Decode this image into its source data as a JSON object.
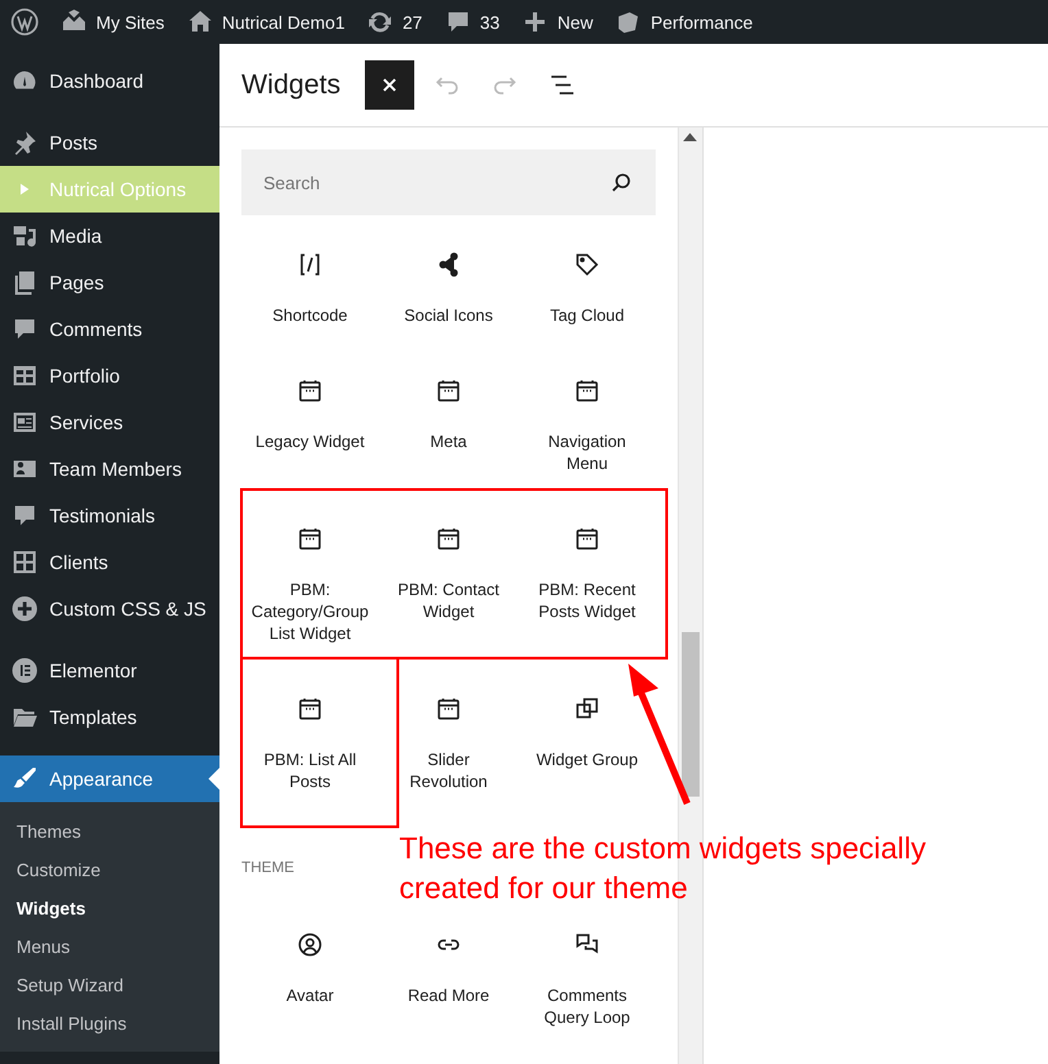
{
  "admin_bar": [
    {
      "kind": "wp"
    },
    {
      "kind": "sites",
      "label": "My Sites"
    },
    {
      "kind": "home",
      "label": "Nutrical Demo1"
    },
    {
      "kind": "updates",
      "label": "27"
    },
    {
      "kind": "comments",
      "label": "33"
    },
    {
      "kind": "new",
      "label": "New"
    },
    {
      "kind": "performance",
      "label": "Performance"
    }
  ],
  "sidebar": {
    "groups": [
      [
        {
          "kind": "dashboard",
          "label": "Dashboard",
          "selected": false,
          "highlighted": false
        }
      ],
      [
        {
          "kind": "pin",
          "label": "Posts",
          "selected": false,
          "highlighted": false
        },
        {
          "kind": "triangle",
          "label": "Nutrical Options",
          "selected": false,
          "highlighted": true
        },
        {
          "kind": "media",
          "label": "Media",
          "selected": false,
          "highlighted": false
        },
        {
          "kind": "pages",
          "label": "Pages",
          "selected": false,
          "highlighted": false
        },
        {
          "kind": "comment",
          "label": "Comments",
          "selected": false,
          "highlighted": false
        },
        {
          "kind": "portfolio",
          "label": "Portfolio",
          "selected": false,
          "highlighted": false
        },
        {
          "kind": "services",
          "label": "Services",
          "selected": false,
          "highlighted": false
        },
        {
          "kind": "team",
          "label": "Team Members",
          "selected": false,
          "highlighted": false
        },
        {
          "kind": "testimonial",
          "label": "Testimonials",
          "selected": false,
          "highlighted": false
        },
        {
          "kind": "grid",
          "label": "Clients",
          "selected": false,
          "highlighted": false
        },
        {
          "kind": "plus",
          "label": "Custom CSS & JS",
          "selected": false,
          "highlighted": false
        }
      ],
      [
        {
          "kind": "elementor",
          "label": "Elementor",
          "selected": false,
          "highlighted": false
        },
        {
          "kind": "folder",
          "label": "Templates",
          "selected": false,
          "highlighted": false
        }
      ],
      [
        {
          "kind": "brush",
          "label": "Appearance",
          "selected": true,
          "highlighted": false,
          "children": [
            {
              "label": "Themes",
              "selected": false
            },
            {
              "label": "Customize",
              "selected": false
            },
            {
              "label": "Widgets",
              "selected": true
            },
            {
              "label": "Menus",
              "selected": false
            },
            {
              "label": "Setup Wizard",
              "selected": false
            },
            {
              "label": "Install Plugins",
              "selected": false
            }
          ]
        }
      ]
    ]
  },
  "header": {
    "title": "Widgets",
    "tools": [
      {
        "kind": "close",
        "active": true,
        "disabled": false
      },
      {
        "kind": "undo",
        "active": false,
        "disabled": true
      },
      {
        "kind": "redo",
        "active": false,
        "disabled": true
      },
      {
        "kind": "list",
        "active": false,
        "disabled": false
      }
    ]
  },
  "inserter": {
    "search": {
      "placeholder": "Search"
    },
    "sections": [
      {
        "blocks": [
          {
            "kind": "shortcode",
            "label": "Shortcode"
          },
          {
            "kind": "share",
            "label": "Social Icons"
          },
          {
            "kind": "tag",
            "label": "Tag Cloud"
          },
          {
            "kind": "calendar",
            "label": "Legacy Widget"
          },
          {
            "kind": "calendar",
            "label": "Meta"
          },
          {
            "kind": "calendar",
            "label": "Navigation Menu"
          },
          {
            "kind": "calendar",
            "label": "PBM: Category/Group List Widget"
          },
          {
            "kind": "calendar",
            "label": "PBM: Contact Widget"
          },
          {
            "kind": "calendar",
            "label": "PBM: Recent Posts Widget"
          },
          {
            "kind": "calendar",
            "label": "PBM: List All Posts"
          },
          {
            "kind": "calendar",
            "label": "Slider Revolution"
          },
          {
            "kind": "group",
            "label": "Widget Group"
          }
        ]
      },
      {
        "title": "THEME",
        "blocks": [
          {
            "kind": "avatar",
            "label": "Avatar"
          },
          {
            "kind": "link",
            "label": "Read More"
          },
          {
            "kind": "comments",
            "label": "Comments Query Loop"
          }
        ]
      }
    ]
  },
  "annotation": {
    "note": "These are the custom widgets specially created for our theme"
  }
}
